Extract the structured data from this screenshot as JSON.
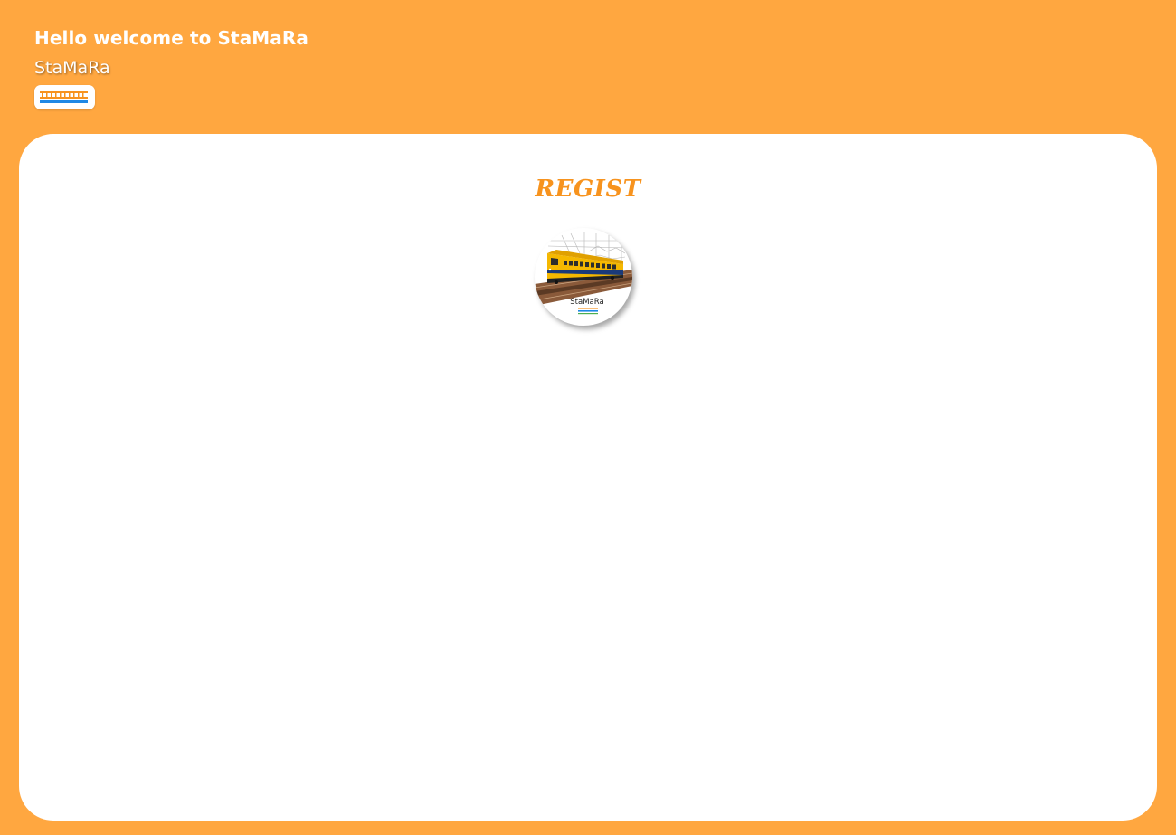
{
  "header": {
    "welcome": "Hello welcome to StaMaRa",
    "brand": "StaMaRa",
    "badge_icon": "rail-track-icon"
  },
  "main": {
    "title": "REGIST",
    "logo_label": "StaMaRa",
    "logo_icon": "train-logo-icon"
  },
  "colors": {
    "background": "#FFA740",
    "card": "#FFFFFF",
    "title": "#F7931E",
    "train": "#F5B800",
    "track_blue": "#1E88E5"
  }
}
